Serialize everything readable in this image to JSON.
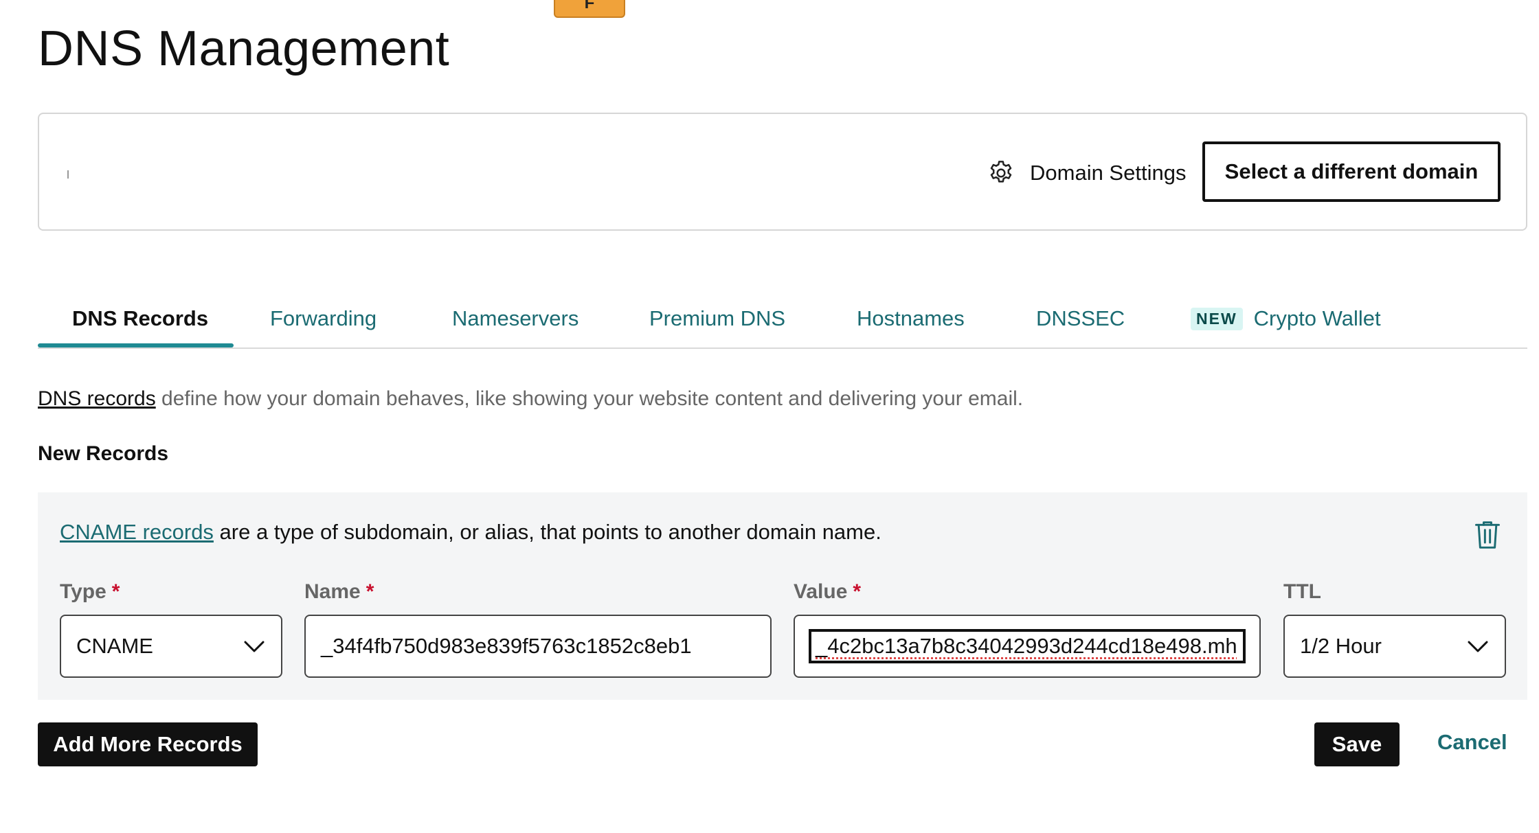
{
  "top_tab": {
    "label": "F"
  },
  "page": {
    "title": "DNS Management"
  },
  "domain_card": {
    "settings_label": "Domain Settings",
    "settings_icon": "gear-icon",
    "select_domain_label": "Select a different domain"
  },
  "tabs": [
    {
      "label": "DNS Records",
      "active": true
    },
    {
      "label": "Forwarding",
      "active": false
    },
    {
      "label": "Nameservers",
      "active": false
    },
    {
      "label": "Premium DNS",
      "active": false
    },
    {
      "label": "Hostnames",
      "active": false
    },
    {
      "label": "DNSSEC",
      "active": false
    },
    {
      "label": "Crypto Wallet",
      "badge": "NEW",
      "active": false
    }
  ],
  "intro": {
    "link": "DNS records",
    "text": " define how your domain behaves, like showing your website content and delivering your email."
  },
  "new_records": {
    "heading": "New Records",
    "description_link": "CNAME records",
    "description_text": " are a type of subdomain, or alias, that points to another domain name.",
    "delete_icon": "trash-icon",
    "fields": {
      "type": {
        "label": "Type",
        "required_mark": "*",
        "value": "CNAME"
      },
      "name": {
        "label": "Name",
        "required_mark": "*",
        "value": "_34f4fb750d983e839f5763c1852c8eb1"
      },
      "value": {
        "label": "Value",
        "required_mark": "*",
        "value": "_4c2bc13a7b8c34042993d244cd18e498.mh"
      },
      "ttl": {
        "label": "TTL",
        "value": "1/2 Hour"
      }
    }
  },
  "actions": {
    "add_more": "Add More Records",
    "save": "Save",
    "cancel": "Cancel"
  },
  "colors": {
    "accent": "#1f8a93",
    "link": "#1b6b72",
    "primary_button": "#111111",
    "required": "#c8102e",
    "panel_background": "#f4f5f6"
  }
}
